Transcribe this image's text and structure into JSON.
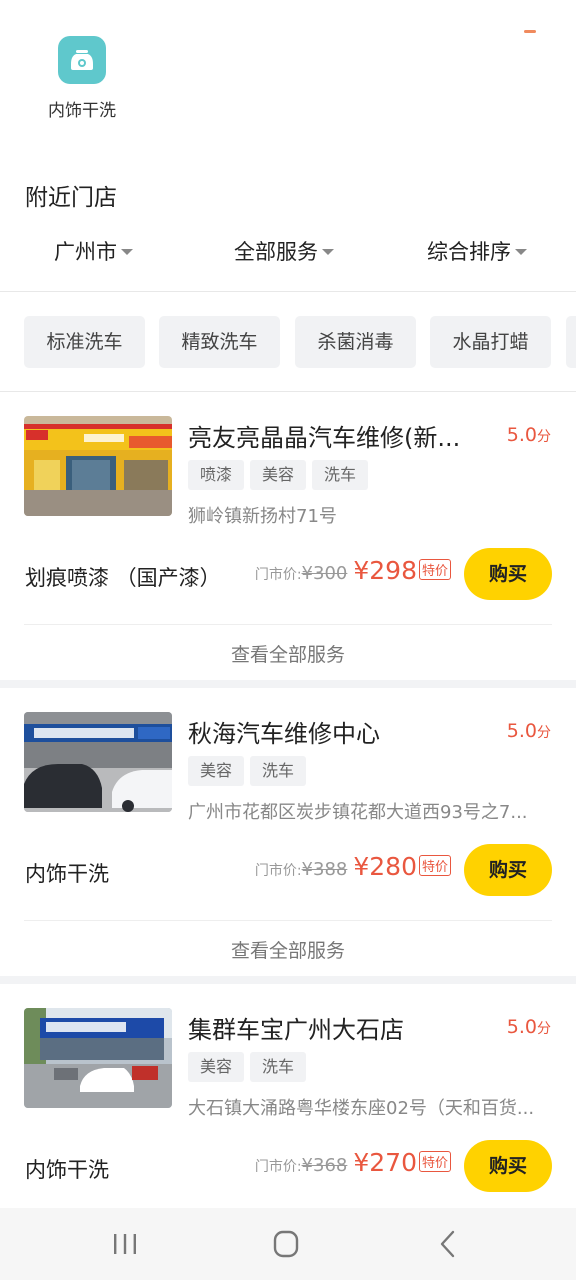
{
  "category": {
    "label": "内饰干洗",
    "icon": "car-wash-icon",
    "color": "#5fc8cc"
  },
  "section_title": "附近门店",
  "filters": [
    {
      "label": "广州市"
    },
    {
      "label": "全部服务"
    },
    {
      "label": "综合排序"
    }
  ],
  "chips": [
    "标准洗车",
    "精致洗车",
    "杀菌消毒",
    "水晶打蜡"
  ],
  "stores": [
    {
      "name": "亮友亮晶晶汽车维修(新...",
      "rating": "5.0",
      "rating_unit": "分",
      "tags": [
        "喷漆",
        "美容",
        "洗车"
      ],
      "address": "狮岭镇新扬村71号",
      "service": "划痕喷漆 （国产漆）",
      "old_label": "门市价:",
      "old_price": "¥300",
      "new_price": "¥298",
      "special": "特价",
      "buy": "购买",
      "view_all": "查看全部服务"
    },
    {
      "name": "秋海汽车维修中心",
      "rating": "5.0",
      "rating_unit": "分",
      "tags": [
        "美容",
        "洗车"
      ],
      "address": "广州市花都区炭步镇花都大道西93号之7...",
      "service": "内饰干洗",
      "old_label": "门市价:",
      "old_price": "¥388",
      "new_price": "¥280",
      "special": "特价",
      "buy": "购买",
      "view_all": "查看全部服务"
    },
    {
      "name": "集群车宝广州大石店",
      "rating": "5.0",
      "rating_unit": "分",
      "tags": [
        "美容",
        "洗车"
      ],
      "address": "大石镇大涌路粤华楼东座02号（天和百货...",
      "service": "内饰干洗",
      "old_label": "门市价:",
      "old_price": "¥368",
      "new_price": "¥270",
      "special": "特价",
      "buy": "购买"
    }
  ],
  "colors": {
    "accent": "#e9573f",
    "buy": "#ffd200",
    "chip_bg": "#f1f2f4"
  },
  "navbar": {
    "icons": [
      "recent-apps-icon",
      "home-icon",
      "back-icon"
    ]
  }
}
